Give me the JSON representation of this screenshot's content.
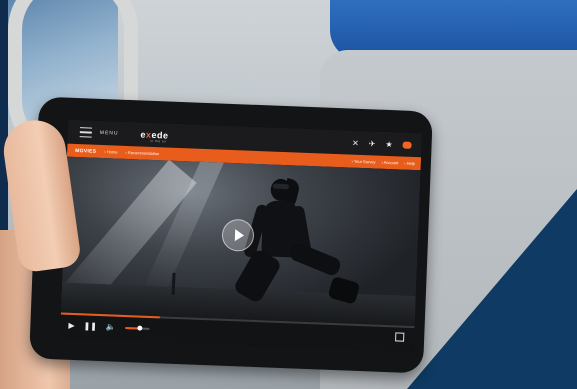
{
  "app": {
    "menu_label": "MENU",
    "logo_prefix": "e",
    "logo_x": "x",
    "logo_suffix": "ede",
    "logo_tagline": "in the air"
  },
  "topbar_icons": [
    "tools-icon",
    "airplane-icon",
    "star-icon",
    "chat-badge-icon"
  ],
  "nav": {
    "section": "MOVIES",
    "breadcrumb": [
      "Home",
      "Recommendation"
    ],
    "right_links": [
      "Your Survey",
      "Account",
      "Help"
    ]
  },
  "player": {
    "progress_fraction": 0.28,
    "volume_fraction": 0.6
  },
  "colors": {
    "accent": "#e85d1c",
    "topbar": "#1b1b1d",
    "seat_blue": "#2f6fbf"
  }
}
